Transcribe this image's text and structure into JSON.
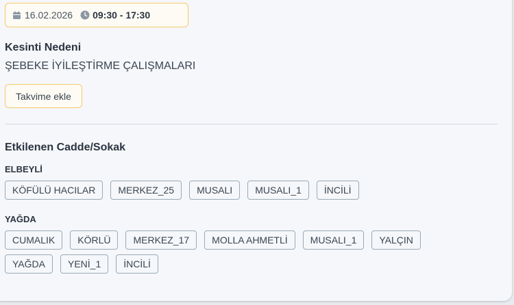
{
  "schedule": {
    "date": "16.02.2026",
    "time": "09:30 - 17:30",
    "date_icon": "calendar-icon",
    "time_icon": "clock-icon"
  },
  "reason": {
    "title": "Kesinti Nedeni",
    "value": "ŞEBEKE İYİLEŞTİRME ÇALIŞMALARI"
  },
  "calendar_button": {
    "label": "Takvime ekle"
  },
  "affected": {
    "title": "Etkilenen Cadde/Sokak",
    "groups": [
      {
        "name": "ELBEYLİ",
        "streets": [
          "KÖFÜLÜ HACILAR",
          "MERKEZ_25",
          "MUSALI",
          "MUSALI_1",
          "İNCİLİ"
        ]
      },
      {
        "name": "YAĞDA",
        "streets": [
          "CUMALIK",
          "KÖRLÜ",
          "MERKEZ_17",
          "MOLLA AHMETLİ",
          "MUSALI_1",
          "YALÇIN",
          "YAĞDA",
          "YENİ_1",
          "İNCİLİ"
        ]
      }
    ]
  },
  "colors": {
    "accent_border": "#f5c96a",
    "tag_border": "#9aaab8",
    "card_bg": "#f5f7fa"
  }
}
